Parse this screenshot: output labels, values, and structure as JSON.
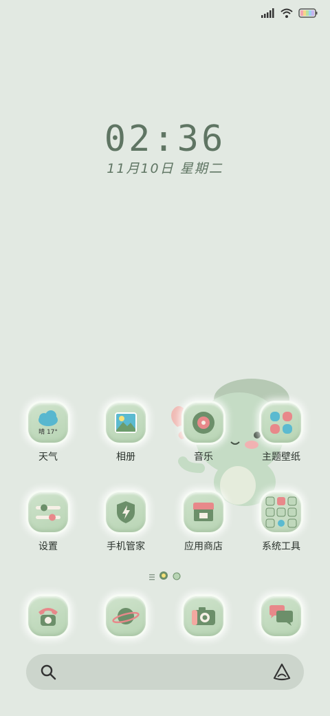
{
  "clock": {
    "time": "02:36",
    "date": "11月10日 星期二"
  },
  "apps": [
    {
      "label": "天气",
      "icon": "weather-icon",
      "temp": "晴 17°"
    },
    {
      "label": "相册",
      "icon": "gallery-icon"
    },
    {
      "label": "音乐",
      "icon": "music-icon"
    },
    {
      "label": "主题壁纸",
      "icon": "theme-icon"
    },
    {
      "label": "设置",
      "icon": "settings-icon"
    },
    {
      "label": "手机管家",
      "icon": "security-shield-icon"
    },
    {
      "label": "应用商店",
      "icon": "app-store-icon"
    },
    {
      "label": "系统工具",
      "icon": "folder-icon"
    }
  ],
  "dock": [
    {
      "icon": "phone-icon"
    },
    {
      "icon": "browser-planet-icon"
    },
    {
      "icon": "camera-icon"
    },
    {
      "icon": "messages-icon"
    }
  ],
  "colors": {
    "background": "#e2e9e2",
    "tile": "#c5dcc1",
    "accent_pink": "#e8888a",
    "accent_blue": "#5bbad0",
    "accent_green": "#6c8f6a"
  }
}
